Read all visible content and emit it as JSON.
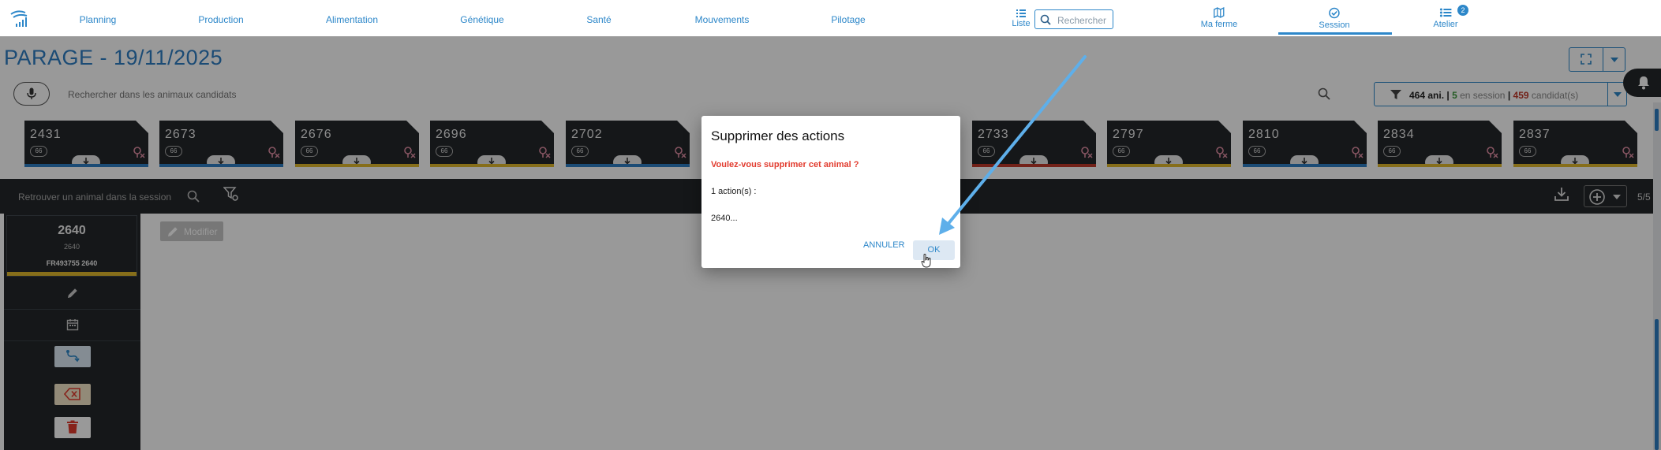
{
  "nav": {
    "items": [
      "Planning",
      "Production",
      "Alimentation",
      "Génétique",
      "Santé",
      "Mouvements",
      "Pilotage"
    ],
    "liste_label": "Liste",
    "search_placeholder": "Rechercher",
    "ferme_label": "Ma ferme",
    "session_label": "Session",
    "atelier_label": "Atelier",
    "atelier_badge": "2"
  },
  "page": {
    "title": "PARAGE - 19/11/2025"
  },
  "candidates": {
    "search_placeholder": "Rechercher dans les animaux candidats",
    "filter": {
      "total": "464 ani.",
      "sep1": "|",
      "in_session_count": "5",
      "in_session_label": "en session",
      "sep2": "|",
      "candidat_count": "459",
      "candidat_label": "candidat(s)"
    }
  },
  "cards": [
    {
      "num": "2431",
      "pill": "66",
      "stripe": "#2d7dc4"
    },
    {
      "num": "2673",
      "pill": "66",
      "stripe": "#2d7dc4"
    },
    {
      "num": "2676",
      "pill": "66",
      "stripe": "#e0b72c"
    },
    {
      "num": "2696",
      "pill": "66",
      "stripe": "#e0b72c"
    },
    {
      "num": "2702",
      "pill": "66",
      "stripe": "#2d7dc4"
    },
    {
      "num": "2733",
      "pill": "66",
      "stripe": "#c0392b"
    },
    {
      "num": "2797",
      "pill": "66",
      "stripe": "#e0b72c"
    },
    {
      "num": "2810",
      "pill": "66",
      "stripe": "#2d7dc4"
    },
    {
      "num": "2834",
      "pill": "66",
      "stripe": "#e0b72c"
    },
    {
      "num": "2837",
      "pill": "66",
      "stripe": "#e0b72c"
    }
  ],
  "session": {
    "search_placeholder": "Retrouver un animal dans la session",
    "count": "5/5",
    "selected": {
      "num": "2640",
      "sub": "2640",
      "id": "FR493755  2640"
    },
    "modifier_label": "Modifier"
  },
  "dialog": {
    "title": "Supprimer des actions",
    "question": "Voulez-vous supprimer cet animal ?",
    "actions": "1 action(s) :",
    "animal": "2640...",
    "cancel": "ANNULER",
    "ok": "OK"
  },
  "colors": {
    "accent": "#2d87c9",
    "danger": "#e23b2e",
    "dark_panel": "#23272a"
  }
}
